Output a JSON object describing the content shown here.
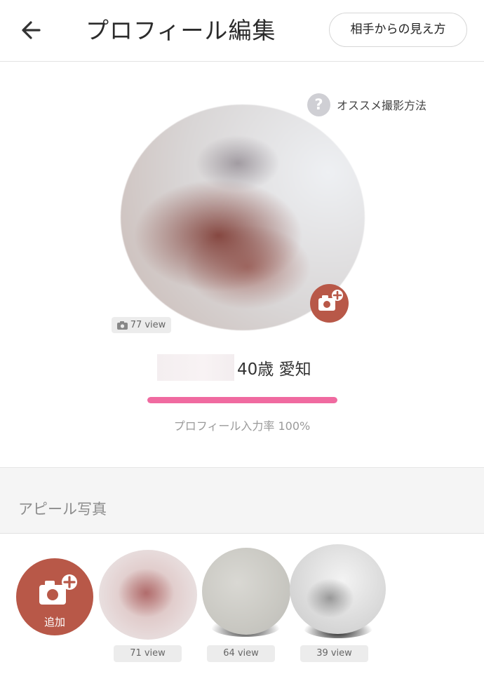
{
  "header": {
    "back_icon": "arrow-left-icon",
    "title": "プロフィール編集",
    "view_as_label": "相手からの見え方"
  },
  "profile": {
    "help_icon": "question-icon",
    "help_label": "オススメ撮影方法",
    "main_photo_view_count": "77 view",
    "age_location": "40歳 愛知",
    "completion_percent": 100,
    "completion_label": "プロフィール入力率 100%"
  },
  "appeal": {
    "section_title": "アピール写真",
    "add_label": "追加",
    "add_icon": "camera-plus-icon",
    "photos": [
      {
        "view_count": "71 view"
      },
      {
        "view_count": "64 view"
      },
      {
        "view_count": "39 view"
      }
    ]
  },
  "colors": {
    "accent_pink": "#f06aa0",
    "add_button": "#b85848"
  }
}
